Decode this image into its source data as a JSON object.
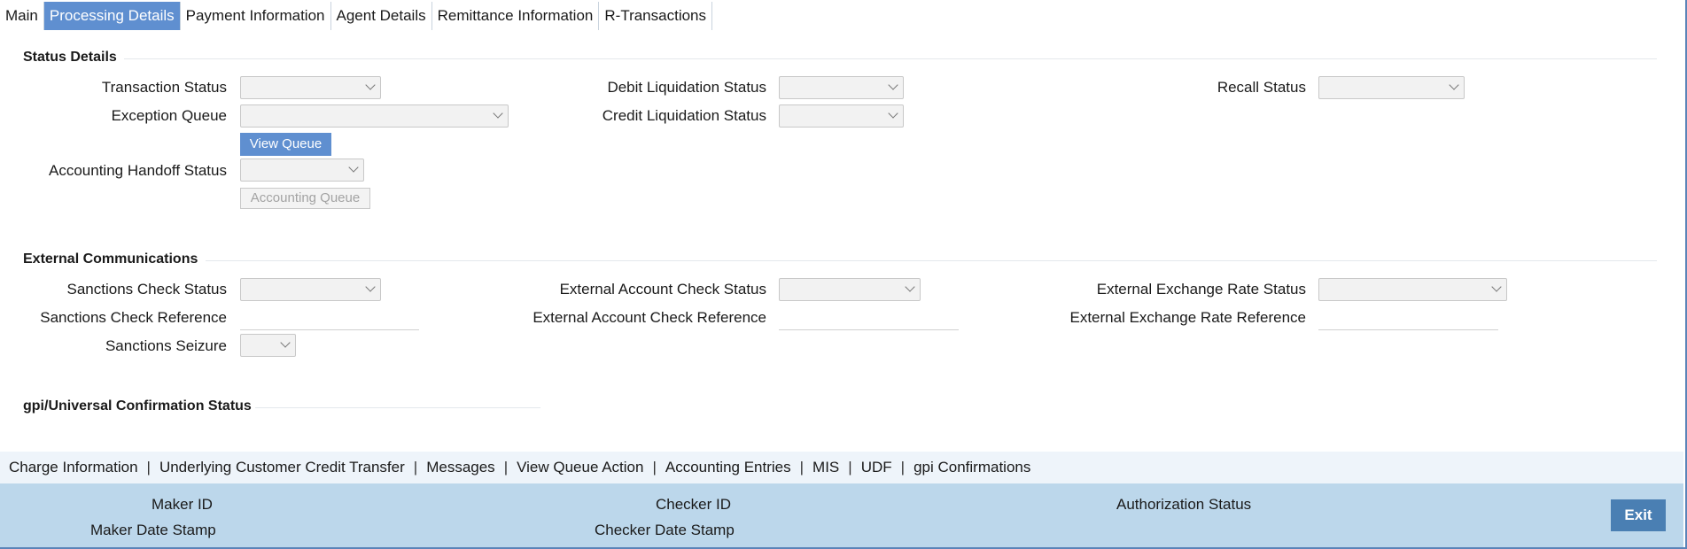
{
  "tabs": [
    "Main",
    "Processing Details",
    "Payment Information",
    "Agent Details",
    "Remittance Information",
    "R-Transactions"
  ],
  "status_details": {
    "heading": "Status Details",
    "transaction_status": "Transaction Status",
    "exception_queue": "Exception Queue",
    "view_queue": "View Queue",
    "accounting_handoff_status": "Accounting Handoff Status",
    "accounting_queue": "Accounting Queue",
    "debit_liquidation_status": "Debit Liquidation Status",
    "credit_liquidation_status": "Credit Liquidation Status",
    "recall_status": "Recall Status"
  },
  "external": {
    "heading": "External Communications",
    "sanctions_check_status": "Sanctions Check Status",
    "sanctions_check_reference": "Sanctions Check Reference",
    "sanctions_seizure": "Sanctions Seizure",
    "external_account_check_status": "External Account Check Status",
    "external_account_check_reference": "External Account Check Reference",
    "external_exchange_rate_status": "External Exchange Rate Status",
    "external_exchange_rate_reference": "External Exchange Rate Reference"
  },
  "gpi": {
    "heading": "gpi/Universal Confirmation Status"
  },
  "bottom_links": [
    "Charge Information",
    "Underlying Customer Credit Transfer",
    "Messages",
    "View Queue Action",
    "Accounting Entries",
    "MIS",
    "UDF",
    "gpi Confirmations"
  ],
  "footer": {
    "maker_id": "Maker ID",
    "maker_date_stamp": "Maker Date Stamp",
    "checker_id": "Checker ID",
    "checker_date_stamp": "Checker Date Stamp",
    "authorization_status": "Authorization Status",
    "exit": "Exit"
  },
  "colors": {
    "accent": "#5f8fd0",
    "footer_bg": "#bcd7eb",
    "exit_bg": "#4a7fb3"
  }
}
